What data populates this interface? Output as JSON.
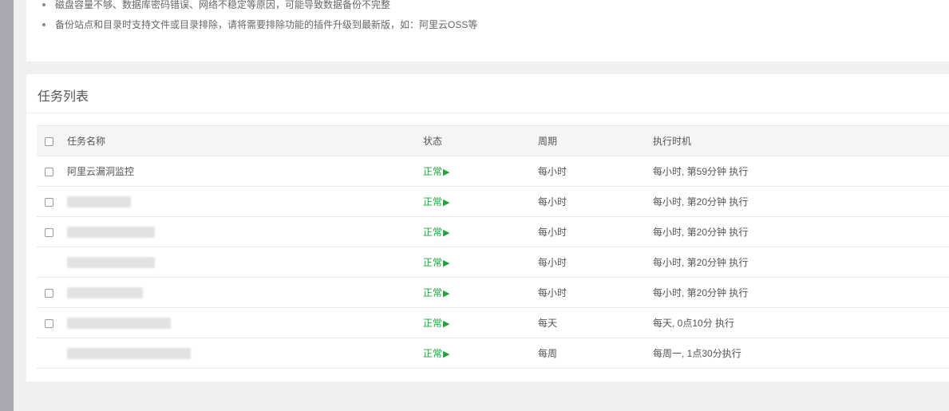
{
  "notes": [
    "磁盘容量不够、数据库密码错误、网络不稳定等原因，可能导致数据备份不完整",
    "备份站点和目录时支持文件或目录排除，请将需要排除功能的插件升级到最新版，如：阿里云OSS等"
  ],
  "panel_title": "任务列表",
  "table": {
    "headers": {
      "name": "任务名称",
      "status": "状态",
      "period": "周期",
      "time": "执行时机"
    },
    "rows": [
      {
        "name": "阿里云漏洞监控",
        "status": "正常",
        "period": "每小时",
        "time": "每小时, 第59分钟 执行"
      },
      {
        "name": "",
        "status": "正常",
        "period": "每小时",
        "time": "每小时, 第20分钟 执行"
      },
      {
        "name": "",
        "status": "正常",
        "period": "每小时",
        "time": "每小时, 第20分钟 执行"
      },
      {
        "name": "",
        "status": "正常",
        "period": "每小时",
        "time": "每小时, 第20分钟 执行"
      },
      {
        "name": "",
        "status": "正常",
        "period": "每小时",
        "time": "每小时, 第20分钟 执行"
      },
      {
        "name": "",
        "status": "正常",
        "period": "每天",
        "time": "每天, 0点10分 执行"
      },
      {
        "name": "",
        "status": "正常",
        "period": "每周",
        "time": "每周一, 1点30分执行"
      }
    ]
  },
  "colors": {
    "status_ok": "#20a53a",
    "header_bg": "#f5f5f5"
  },
  "icons": {
    "status_indicator": "play-triangle-icon"
  }
}
